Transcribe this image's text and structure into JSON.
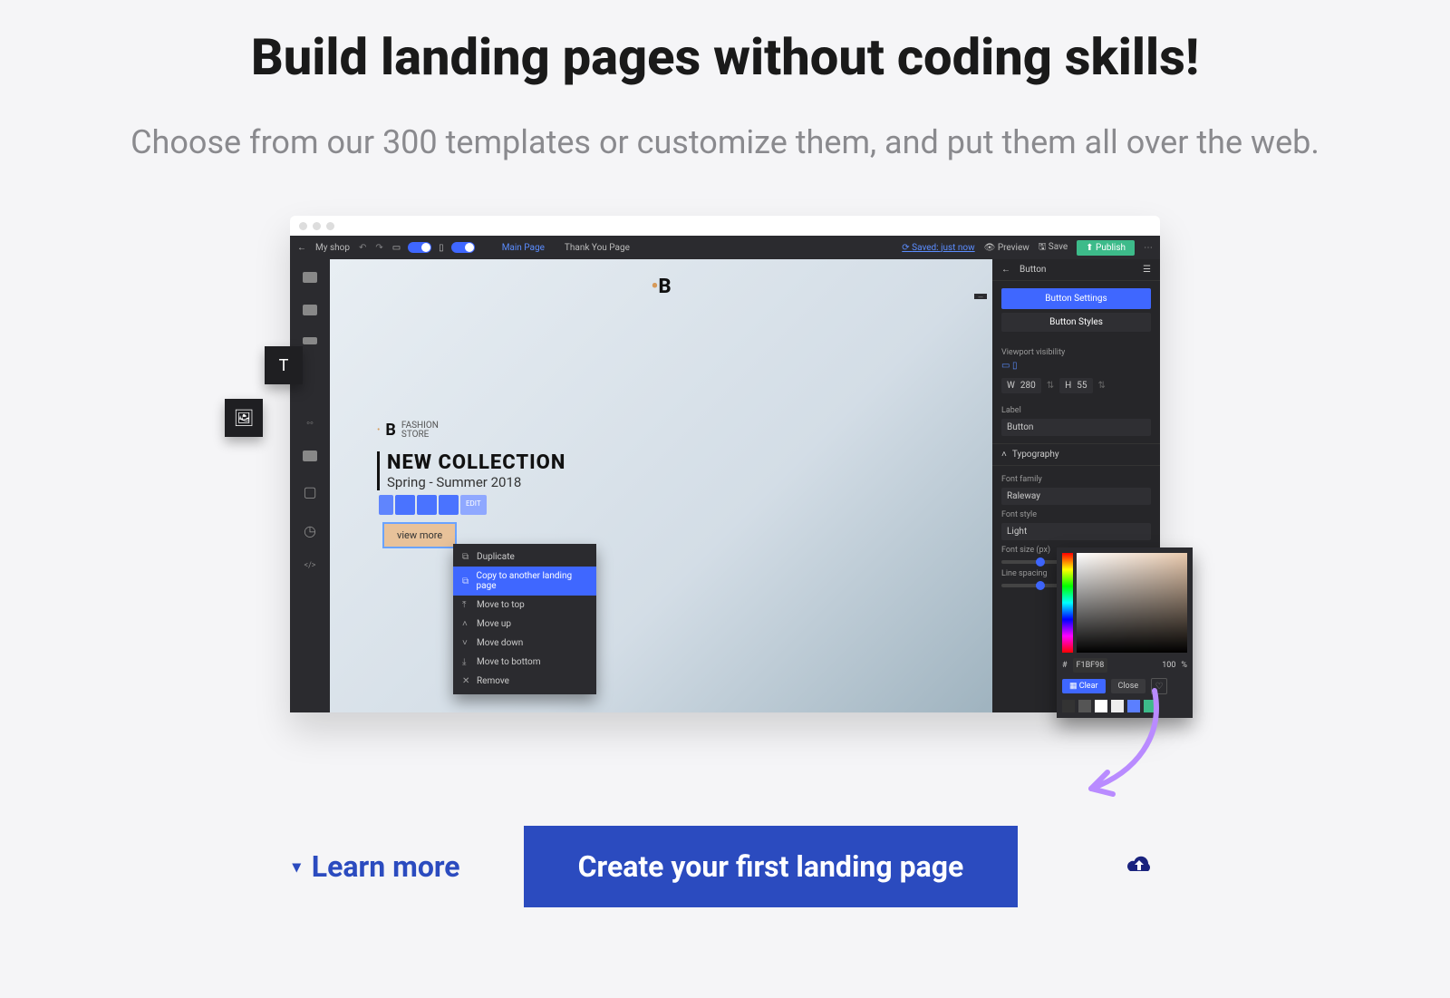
{
  "hero": {
    "headline": "Build landing pages without coding skills!",
    "subhead": "Choose from our 300 templates or customize them, and put them all over the web."
  },
  "editor": {
    "project_name": "My shop",
    "tabs": {
      "main": "Main Page",
      "thanks": "Thank You Page"
    },
    "saved_label": "Saved: just now",
    "preview": "Preview",
    "save": "Save",
    "publish": "Publish"
  },
  "canvas": {
    "brand_letter": "B",
    "fashion_store_label": "FASHION\nSTORE",
    "collection_title": "NEW COLLECTION",
    "collection_sub": "Spring - Summer 2018",
    "edit_chip": "EDIT",
    "view_more": "view more"
  },
  "context_menu": {
    "items": [
      "Duplicate",
      "Copy to another landing page",
      "Move to top",
      "Move up",
      "Move down",
      "Move to bottom",
      "Remove"
    ],
    "highlight_index": 1
  },
  "right_panel": {
    "title": "Button",
    "tab_settings": "Button Settings",
    "tab_styles": "Button Styles",
    "viewport_label": "Viewport visibility",
    "width_label": "W",
    "width_value": "280",
    "height_label": "H",
    "height_value": "55",
    "label_label": "Label",
    "label_value": "Button",
    "typography": "Typography",
    "font_family_label": "Font family",
    "font_family_value": "Raleway",
    "font_style_label": "Font style",
    "font_style_value": "Light",
    "font_size_label": "Font size (px)",
    "line_spacing_label": "Line spacing"
  },
  "picker": {
    "hash": "#",
    "hex": "F1BF98",
    "opacity": "100",
    "pct": "%",
    "clear": "Clear",
    "close": "Close",
    "swatches": [
      "#333333",
      "#555555",
      "#ffffff",
      "#eeeeee",
      "#5b7fff",
      "#3dbb8a"
    ]
  },
  "footer": {
    "learn_more": "Learn more",
    "cta": "Create your first landing page"
  }
}
